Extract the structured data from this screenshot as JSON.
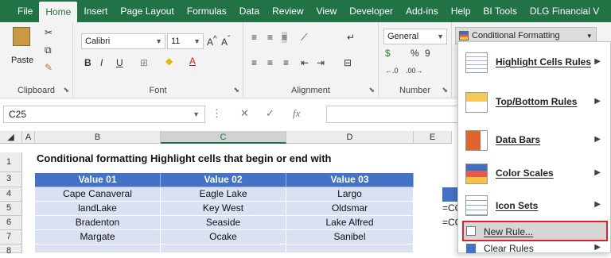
{
  "ribbon_tabs": [
    "File",
    "Home",
    "Insert",
    "Page Layout",
    "Formulas",
    "Data",
    "Review",
    "View",
    "Developer",
    "Add-ins",
    "Help",
    "BI Tools",
    "DLG Financial V"
  ],
  "active_tab": "Home",
  "clipboard": {
    "paste_label": "Paste",
    "group_label": "Clipboard"
  },
  "font": {
    "name": "Calibri",
    "size": "11",
    "bold": "B",
    "italic": "I",
    "underline": "U",
    "group_label": "Font"
  },
  "alignment": {
    "group_label": "Alignment"
  },
  "number": {
    "format": "General",
    "percent": "%",
    "comma": "9",
    "group_label": "Number"
  },
  "conditional_formatting_label": "Conditional Formatting",
  "namebox": {
    "value": "C25"
  },
  "formula_bar": {
    "fx": "fx",
    "cancel": "✕",
    "enter": "✓"
  },
  "columns": [
    "A",
    "B",
    "C",
    "D",
    "E"
  ],
  "rows": [
    "1",
    "3",
    "4",
    "5",
    "6",
    "7",
    "8"
  ],
  "sheet_title": "Conditional formatting Highlight cells that begin or end with",
  "table": {
    "headers": [
      "Value 01",
      "Value 02",
      "Value 03"
    ],
    "rows": [
      [
        "Cape Canaveral",
        "Eagle Lake",
        "Largo"
      ],
      [
        "landLake",
        "Key West",
        "Oldsmar"
      ],
      [
        "Bradenton",
        "Seaside",
        "Lake Alfred"
      ],
      [
        "Margate",
        "Ocake",
        "Sanibel"
      ]
    ]
  },
  "side_cells": [
    "=CO",
    "=CO"
  ],
  "menu": {
    "items": [
      {
        "label": "Highlight Cells Rules",
        "icon": "highlight-cells-icon",
        "submenu": true
      },
      {
        "label": "Top/Bottom Rules",
        "icon": "top-bottom-icon",
        "submenu": true
      },
      {
        "label": "Data Bars",
        "icon": "data-bars-icon",
        "submenu": true
      },
      {
        "label": "Color Scales",
        "icon": "color-scales-icon",
        "submenu": true
      },
      {
        "label": "Icon Sets",
        "icon": "icon-sets-icon",
        "submenu": true
      },
      {
        "label": "New Rule...",
        "icon": "new-rule-icon",
        "submenu": false
      },
      {
        "label": "Clear Rules",
        "icon": "clear-rules-icon",
        "submenu": true
      }
    ]
  },
  "colors": {
    "excel_green": "#217346",
    "table_header": "#4472c4",
    "table_body": "#d9e1f2",
    "highlight_border": "#e0202a"
  }
}
